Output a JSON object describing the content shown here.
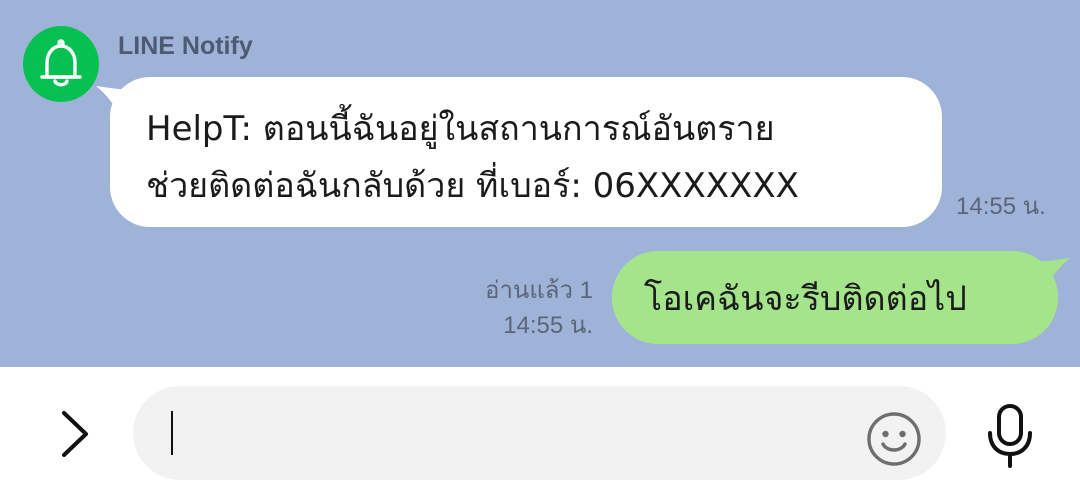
{
  "chat": {
    "background": "#9fb3d9",
    "incoming": {
      "sender": "LINE Notify",
      "avatar_icon": "bell-icon",
      "avatar_color": "#06c152",
      "lines": [
        "HelpT: ตอนนี้ฉันอยู่ในสถานการณ์อันตราย",
        "ช่วยติดต่อฉันกลับด้วย ที่เบอร์: 06XXXXXXX"
      ],
      "time": "14:55 น."
    },
    "outgoing": {
      "text": "โอเคฉันจะรีบติดต่อไป",
      "bubble_color": "#a4e58c",
      "read_status": "อ่านแล้ว 1",
      "time": "14:55 น."
    }
  },
  "input_bar": {
    "expand_icon": "chevron-right-icon",
    "input_value": "",
    "emoji_icon": "smiley-icon",
    "mic_icon": "microphone-icon"
  }
}
